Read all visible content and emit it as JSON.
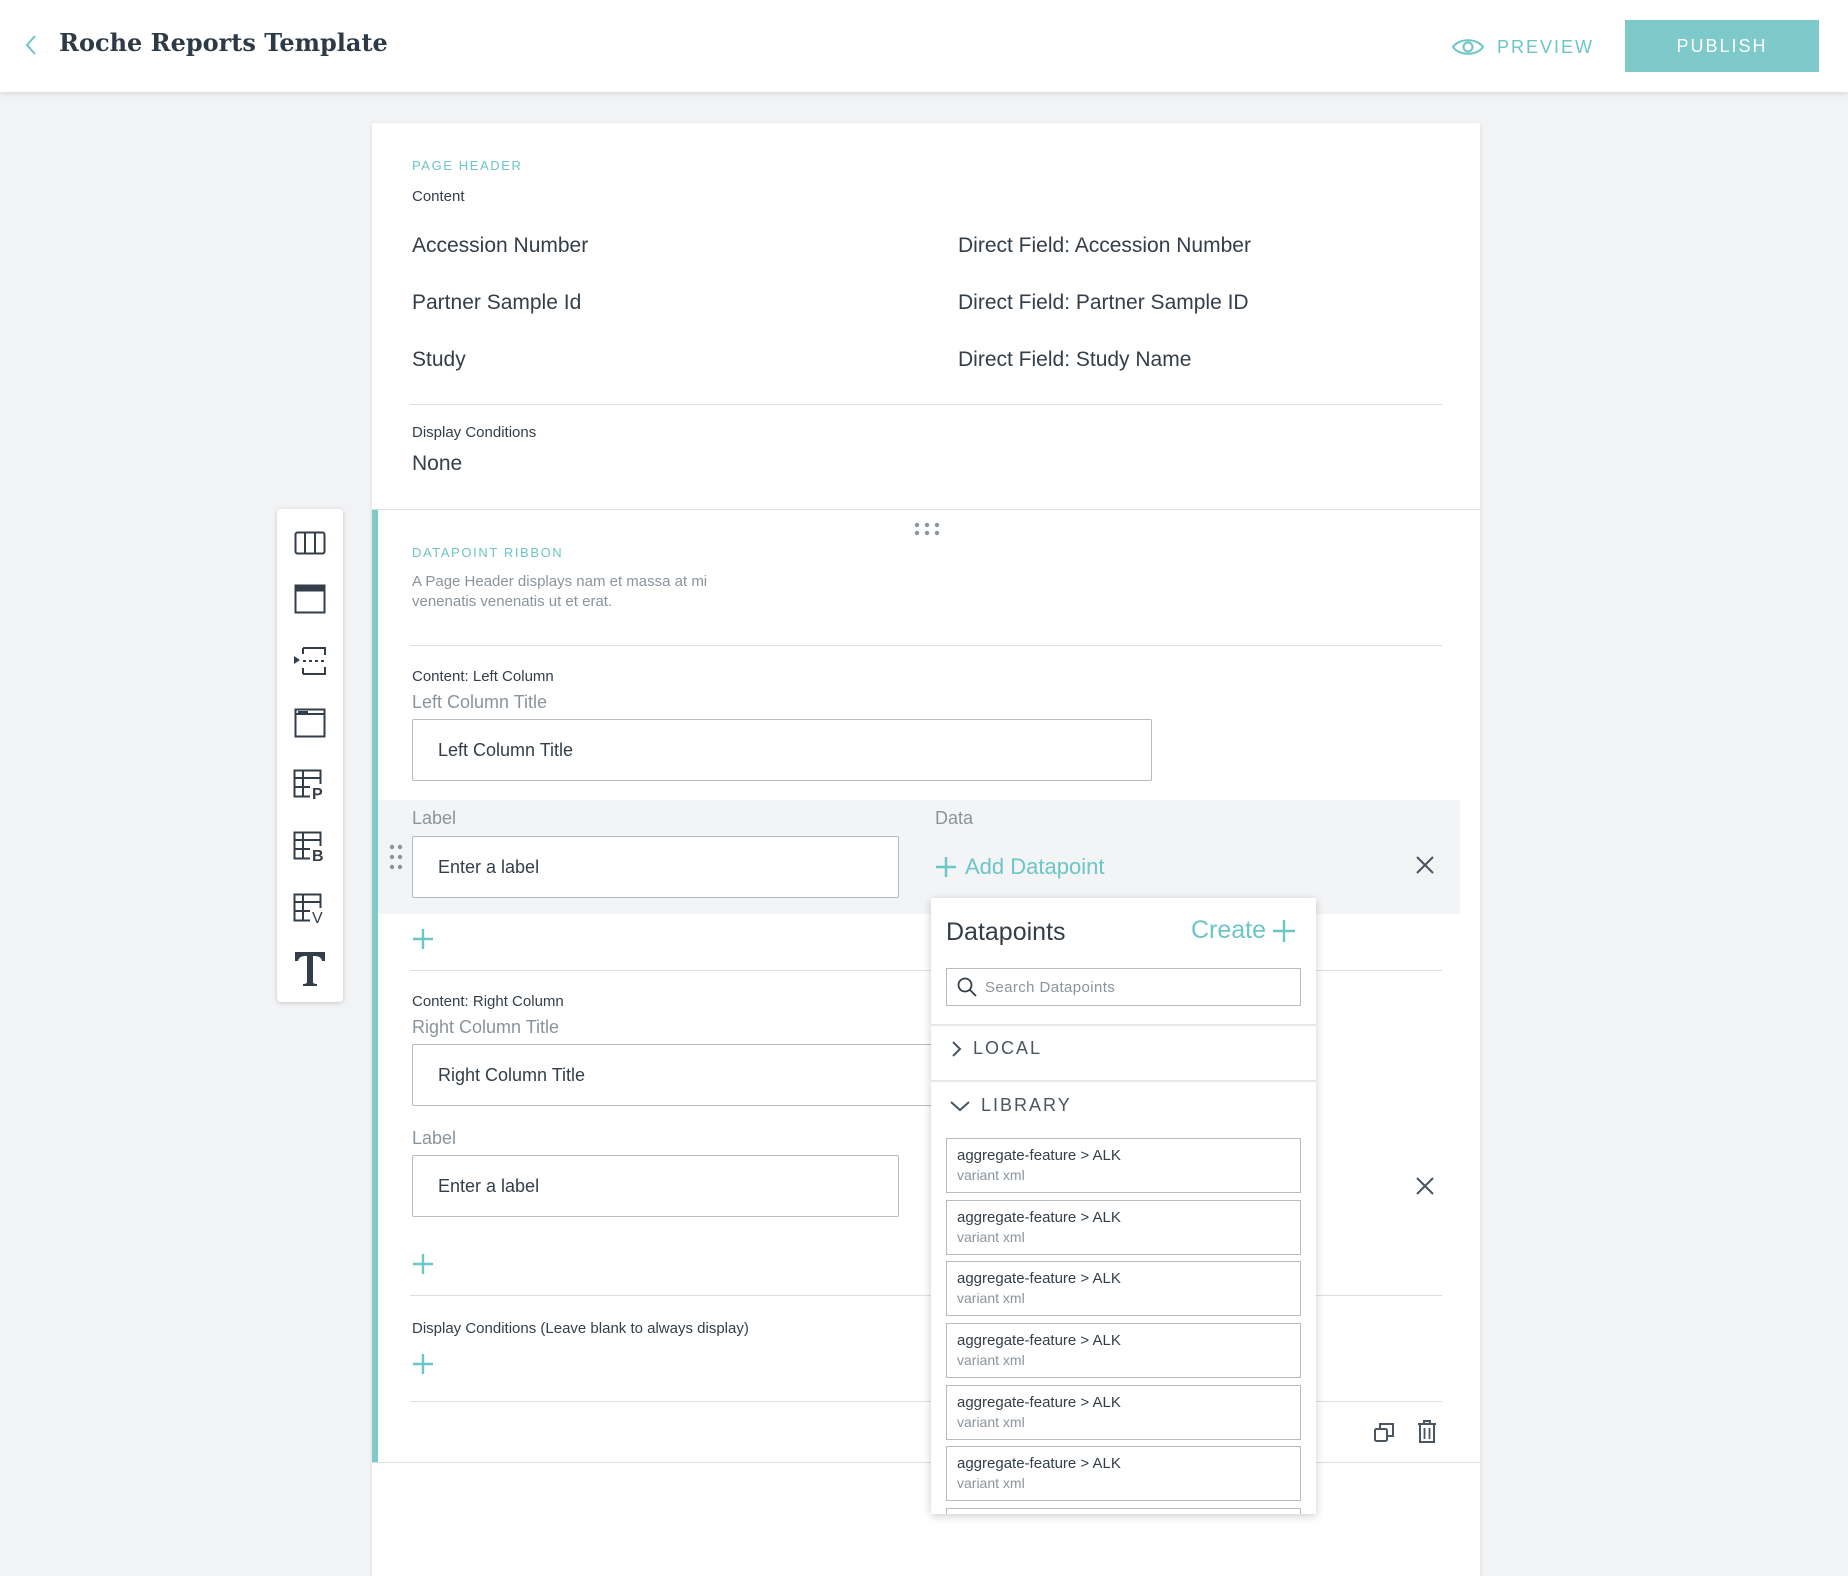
{
  "topbar": {
    "title": "Roche Reports Template",
    "preview_label": "PREVIEW",
    "publish_label": "PUBLISH"
  },
  "page_header": {
    "section_tag": "PAGE HEADER",
    "content_label": "Content",
    "rows": [
      {
        "label": "Accession Number",
        "value": "Direct Field:  Accession Number"
      },
      {
        "label": "Partner Sample Id",
        "value": "Direct Field: Partner Sample ID"
      },
      {
        "label": "Study",
        "value": "Direct Field: Study Name"
      }
    ],
    "display_conditions_label": "Display Conditions",
    "display_conditions_value": "None"
  },
  "ribbon": {
    "section_tag": "DATAPOINT RIBBON",
    "description": "A Page Header displays nam et massa at mi venenatis venenatis ut et erat.",
    "left": {
      "content_label": "Content: Left Column",
      "title_label": "Left Column Title",
      "title_value": "Left Column Title",
      "label_heading": "Label",
      "data_heading": "Data",
      "label_placeholder": "Enter a label",
      "add_datapoint": "Add Datapoint"
    },
    "right": {
      "content_label": "Content: Right Column",
      "title_label": "Right Column Title",
      "title_value": "Right Column Title",
      "label_heading": "Label",
      "label_placeholder": "Enter a label"
    },
    "display_conditions_label": "Display Conditions (Leave blank to always display)"
  },
  "datapoints": {
    "title": "Datapoints",
    "create_label": "Create",
    "search_placeholder": "Search Datapoints",
    "groups": [
      {
        "label": "LOCAL",
        "expanded": false
      },
      {
        "label": "LIBRARY",
        "expanded": true
      }
    ],
    "items": [
      {
        "title": "aggregate-feature > ALK",
        "sub": "variant xml"
      },
      {
        "title": "aggregate-feature > ALK",
        "sub": "variant xml"
      },
      {
        "title": "aggregate-feature > ALK",
        "sub": "variant xml"
      },
      {
        "title": "aggregate-feature > ALK",
        "sub": "variant xml"
      },
      {
        "title": "aggregate-feature > ALK",
        "sub": "variant xml"
      },
      {
        "title": "aggregate-feature > ALK",
        "sub": "variant xml"
      }
    ]
  },
  "toolbar": {
    "tools": [
      "columns-icon",
      "header-block-icon",
      "insert-section-icon",
      "header-block-alt-icon",
      "table-p-icon",
      "table-b-icon",
      "table-v-icon",
      "text-icon"
    ]
  },
  "colors": {
    "accent": "#7ec9ca",
    "accent_text": "#6cc5c6",
    "text": "#333e48",
    "muted": "#8a949c"
  }
}
